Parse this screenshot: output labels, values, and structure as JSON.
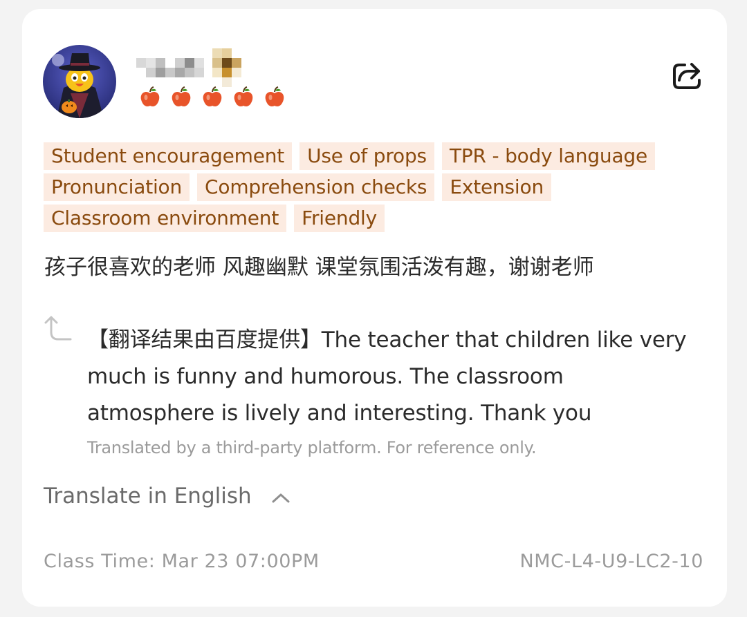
{
  "review": {
    "user": {
      "name": "",
      "avatar_icon": "halloween-cartoon-avatar",
      "rating": 5,
      "rating_icon": "apple-icon",
      "rating_color": "#e8542a"
    },
    "share_icon": "share-icon",
    "tags": [
      [
        "Student encouragement",
        "Use of props",
        "TPR - body language"
      ],
      [
        "Pronunciation",
        "Comprehension checks",
        "Extension"
      ],
      [
        "Classroom environment",
        "Friendly"
      ]
    ],
    "comment": "孩子很喜欢的老师 风趣幽默 课堂氛围活泼有趣，谢谢老师",
    "translation": {
      "icon": "translate-return-icon",
      "text": "【翻译结果由百度提供】The teacher that children like very much is funny and humorous. The classroom atmosphere is lively and interesting. Thank you",
      "disclaimer": "Translated by a third-party platform. For reference only."
    },
    "translate_toggle": {
      "label": "Translate in English",
      "icon": "chevron-up-icon"
    },
    "class_time": "Class Time: Mar 23 07:00PM",
    "class_code": "NMC-L4-U9-LC2-10"
  },
  "colors": {
    "tag_bg": "#fcebe1",
    "tag_text": "#8a4b0f",
    "text_primary": "#2b2b2b",
    "text_secondary": "#9b9b9b"
  }
}
